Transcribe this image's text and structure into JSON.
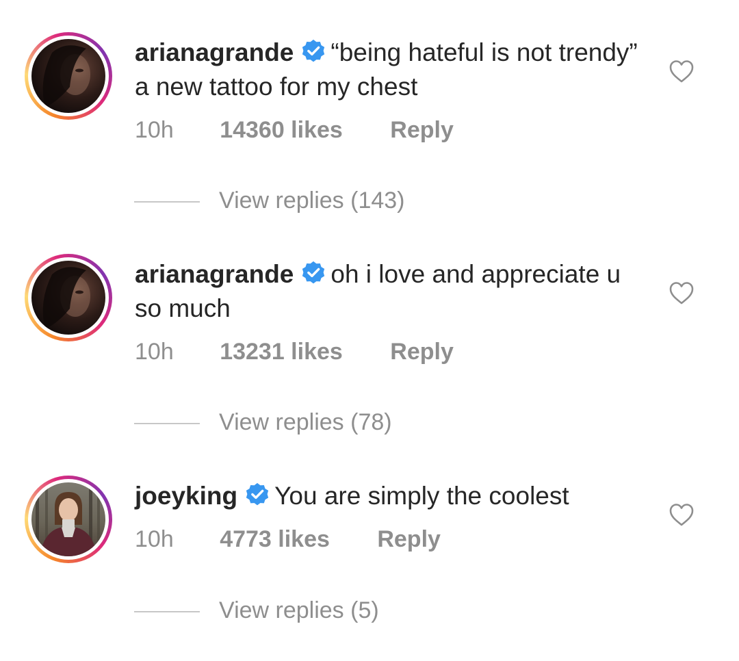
{
  "comments": [
    {
      "username": "arianagrande",
      "verified": true,
      "text": "“being hateful is not trendy” a new tattoo for my chest",
      "time": "10h",
      "likes": "14360 likes",
      "reply": "Reply",
      "view_replies": "View replies (143)"
    },
    {
      "username": "arianagrande",
      "verified": true,
      "text": "oh i love and appreciate u so much",
      "time": "10h",
      "likes": "13231 likes",
      "reply": "Reply",
      "view_replies": "View replies (78)"
    },
    {
      "username": "joeyking",
      "verified": true,
      "text": "You are simply the coolest",
      "time": "10h",
      "likes": "4773 likes",
      "reply": "Reply",
      "view_replies": "View replies (5)"
    }
  ],
  "icons": {
    "verified": "verified-badge-icon",
    "like": "heart-outline-icon"
  },
  "colors": {
    "verified_blue": "#3897f0",
    "text": "#262626",
    "secondary_text": "#8e8e8e",
    "story_ring": [
      "#f58529",
      "#dd2a7b",
      "#8134af"
    ]
  }
}
